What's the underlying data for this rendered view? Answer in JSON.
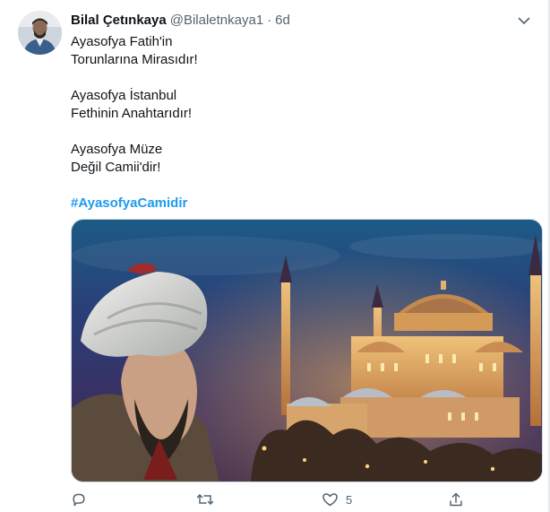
{
  "tweet": {
    "display_name": "Bilal Çetınkaya",
    "handle": "@Bilaletnkaya1",
    "separator": "·",
    "time": "6d",
    "lines": [
      "Ayasofya Fatih'in",
      "Torunlarına Mirasıdır!",
      "Ayasofya İstanbul",
      "Fethinin Anahtarıdır!",
      "Ayasofya Müze",
      "Değil Camii'dir!"
    ],
    "hashtag": "#AyasofyaCamidir",
    "media_icon": "photo-hagia-sophia-night-with-sultan-portrait"
  },
  "actions": {
    "reply_icon": "reply-icon",
    "retweet_icon": "retweet-icon",
    "like_icon": "heart-icon",
    "like_count": "5",
    "share_icon": "share-icon"
  },
  "colors": {
    "link": "#1d9bf0",
    "muted": "#536471",
    "text": "#0f1419"
  }
}
